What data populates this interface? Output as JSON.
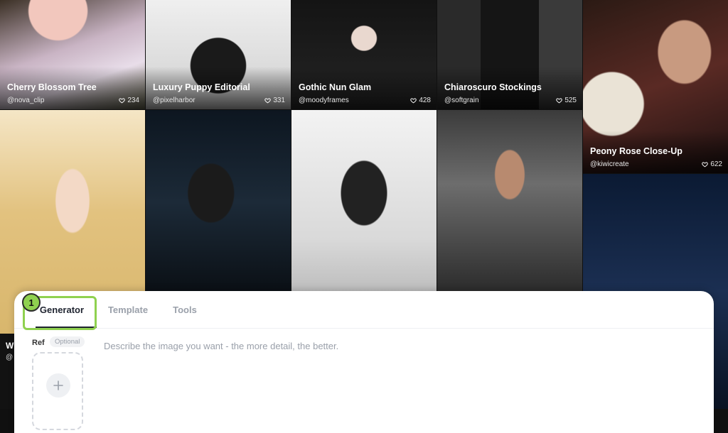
{
  "gallery": {
    "cards": [
      {
        "title": "Cherry Blossom Tree",
        "user": "@nova_clip",
        "likes": "234"
      },
      {
        "title": "Luxury Puppy Editorial",
        "user": "@pixelharbor",
        "likes": "331"
      },
      {
        "title": "Gothic Nun Glam",
        "user": "@moodyframes",
        "likes": "428"
      },
      {
        "title": "Chiaroscuro Stockings",
        "user": "@softgrain",
        "likes": "525"
      },
      {
        "title": "Peony Rose Close-Up",
        "user": "@kiwicreate",
        "likes": "622"
      }
    ],
    "peek": {
      "title": "W",
      "user": "@"
    }
  },
  "panel": {
    "tabs": [
      "Generator",
      "Template",
      "Tools"
    ],
    "active_tab": "Generator",
    "step_badge": "1",
    "ref_label": "Ref",
    "optional_label": "Optional",
    "prompt_placeholder": "Describe the image you want - the more detail, the better."
  },
  "colors": {
    "highlight": "#8fd14f",
    "active_tab": "#1f2430",
    "muted": "#9aa0aa"
  },
  "icons": {
    "like": "heart-icon",
    "add": "plus-icon"
  }
}
